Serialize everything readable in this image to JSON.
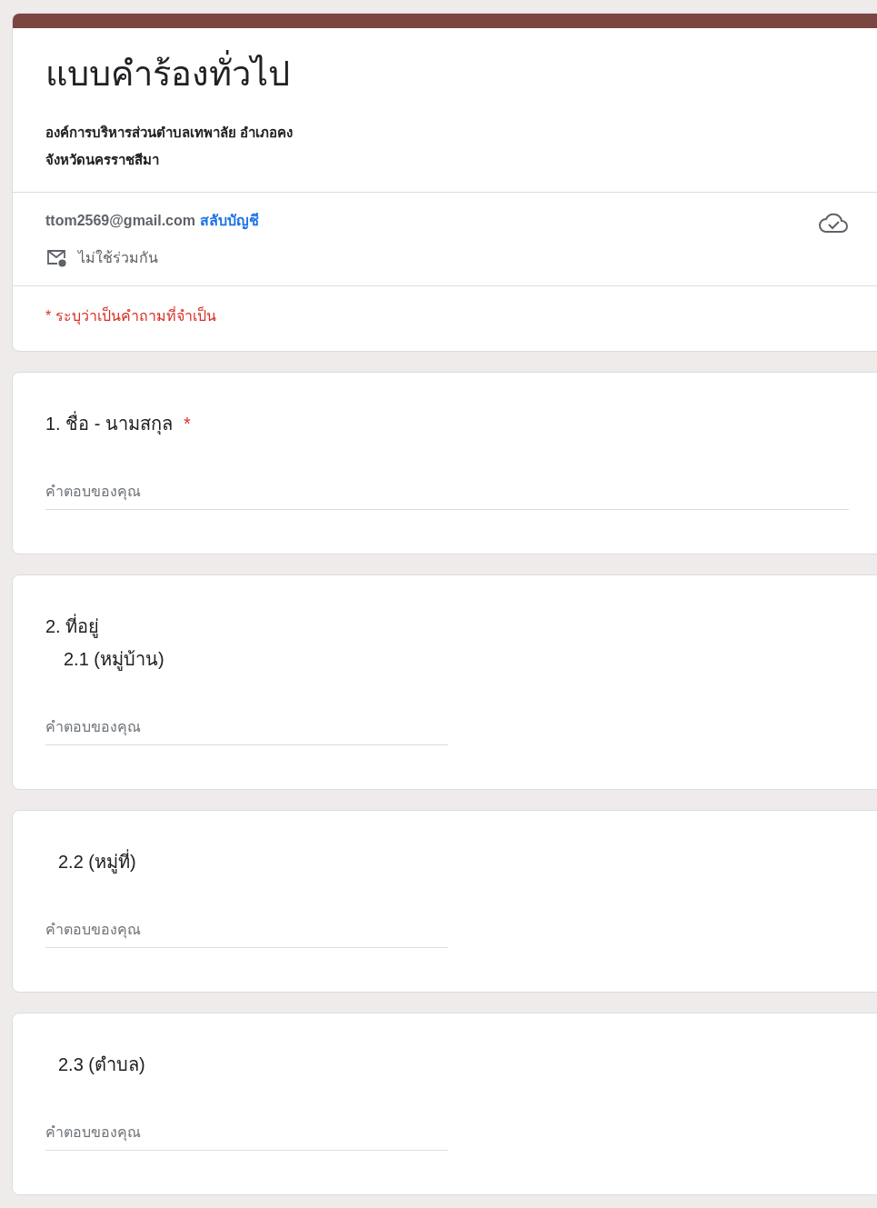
{
  "form": {
    "title": "แบบคำร้องทั่วไป",
    "description_lines": [
      "องค์การบริหารส่วนตำบลเทพาลัย  อำเภอคง",
      "จังหวัดนครราชสีมา"
    ],
    "account": {
      "email": "ttom2569@gmail.com",
      "switch_link": "สลับบัญชี",
      "sharing_note": "ไม่ใช้ร่วมกัน"
    },
    "required_note": "* ระบุว่าเป็นคำถามที่จำเป็น",
    "required_symbol": "*"
  },
  "questions": [
    {
      "lines": [
        {
          "kind": "main",
          "text": "1. ชื่อ - นามสกุล"
        }
      ],
      "required": true,
      "answer": {
        "kind": "wide",
        "placeholder": "คำตอบของคุณ"
      }
    },
    {
      "lines": [
        {
          "kind": "main",
          "text": "2. ที่อยู่"
        },
        {
          "kind": "sub",
          "text": "2.1 (หมู่บ้าน)"
        }
      ],
      "required": false,
      "answer": {
        "kind": "narrow",
        "placeholder": "คำตอบของคุณ"
      }
    },
    {
      "lines": [
        {
          "kind": "sub",
          "text": "2.2 (หมู่ที่)"
        }
      ],
      "required": false,
      "answer": {
        "kind": "narrow",
        "placeholder": "คำตอบของคุณ"
      }
    },
    {
      "lines": [
        {
          "kind": "sub",
          "text": "2.3 (ตำบล)"
        }
      ],
      "required": false,
      "answer": {
        "kind": "narrow",
        "placeholder": "คำตอบของคุณ"
      }
    }
  ]
}
